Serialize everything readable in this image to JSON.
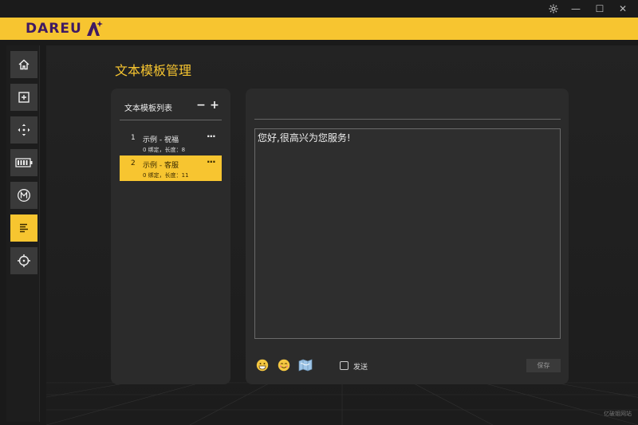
{
  "titlebar": {
    "settings_icon": "gear-icon",
    "minimize": "—",
    "maximize": "☐",
    "close": "✕"
  },
  "brand": {
    "logo_text": "DAREU",
    "accent": "#f7c530",
    "logo_color": "#3f1a63"
  },
  "sidebar": {
    "items": [
      {
        "icon": "home-icon",
        "active": false
      },
      {
        "icon": "plus-square-icon",
        "active": false
      },
      {
        "icon": "move-arrows-icon",
        "active": false
      },
      {
        "icon": "battery-icon",
        "active": false
      },
      {
        "icon": "macro-m-icon",
        "active": false
      },
      {
        "icon": "text-lines-icon",
        "active": true
      },
      {
        "icon": "crosshair-icon",
        "active": false
      }
    ]
  },
  "page": {
    "title": "文本模板管理"
  },
  "template_list": {
    "header": "文本模板列表",
    "remove_label": "−",
    "add_label": "+",
    "items": [
      {
        "num": "1",
        "title": "示例 - 祝福",
        "info": "0 绑定，长度：8",
        "more": "···",
        "active": false
      },
      {
        "num": "2",
        "title": "示例 - 客服",
        "info": "0 绑定，长度：11",
        "more": "···",
        "active": true
      }
    ]
  },
  "editor": {
    "content": "您好,很高兴为您服务!",
    "send_label": "发送",
    "send_checked": false,
    "save_label": "保存",
    "emoji_icons": [
      "grin-emoji-icon",
      "smirk-emoji-icon",
      "map-emoji-icon"
    ]
  },
  "watermark": "亿破姐网站"
}
